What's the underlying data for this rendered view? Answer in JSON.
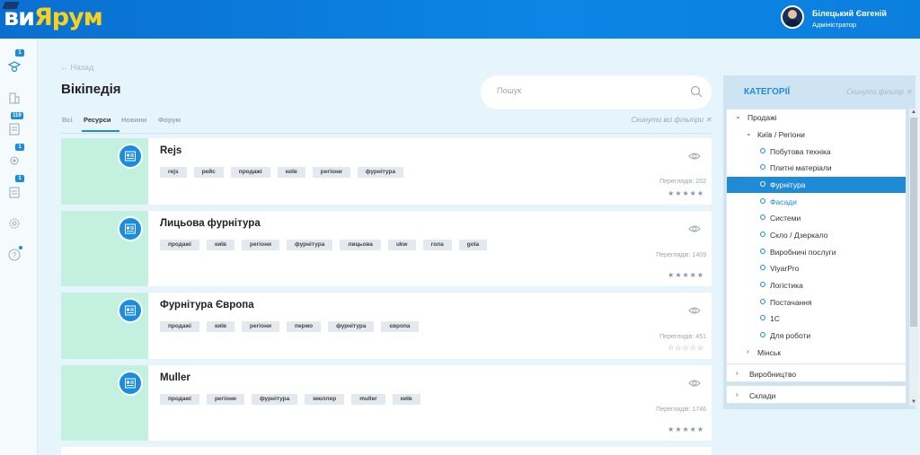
{
  "app": {
    "logo_white": "ви",
    "logo_yellow": "Ярум"
  },
  "user": {
    "name": "Білецький Євгеній",
    "role": "Адміністратор"
  },
  "rail": {
    "badges": [
      "1",
      "119",
      "1",
      "1"
    ]
  },
  "page": {
    "back_label": "Назад",
    "title": "Вікіпедія"
  },
  "search": {
    "placeholder": "Пошук"
  },
  "tabs": [
    {
      "label": "Всі"
    },
    {
      "label": "Ресурси"
    },
    {
      "label": "Новини"
    },
    {
      "label": "Форум"
    }
  ],
  "reset_filters": "Скинути всі фільтри",
  "cards": [
    {
      "title": "Rejs",
      "tags": [
        "rejs",
        "рейс",
        "продажі",
        "київ",
        "регіони",
        "фурнітура"
      ],
      "views": "Переглядів: 202",
      "rating": 0
    },
    {
      "title": "Лицьова фурнітура",
      "tags": [
        "продажі",
        "київ",
        "регіони",
        "фурнітура",
        "лицьова",
        "ukw",
        "гола",
        "gola"
      ],
      "views": "Переглядів: 1409",
      "rating": 0
    },
    {
      "title": "Фурнітура Європа",
      "tags": [
        "продажі",
        "київ",
        "регіони",
        "пермо",
        "фурнітура",
        "європа"
      ],
      "views": "Переглядів: 451",
      "rating": 0
    },
    {
      "title": "Muller",
      "tags": [
        "продажі",
        "регіони",
        "фурнітура",
        "мюллер",
        "muller",
        "київ"
      ],
      "views": "Переглядів: 1746",
      "rating": 0
    }
  ],
  "categories": {
    "title": "КАТЕГОРІЇ",
    "reset": "Скинути фільтр",
    "root": "Продажі",
    "sub": "Київ / Регіони",
    "items": [
      "Побутова техніка",
      "Плитні матеріали",
      "Фурнітура",
      "Фасади",
      "Системи",
      "Скло / Дзеркало",
      "Виробничі послуги",
      "ViyarPro",
      "Логістика",
      "Постачання",
      "1С",
      "Для роботи"
    ],
    "selected": "Фурнітура",
    "sub2": "Мінськ",
    "groups": [
      "Виробництво",
      "Склади"
    ]
  }
}
